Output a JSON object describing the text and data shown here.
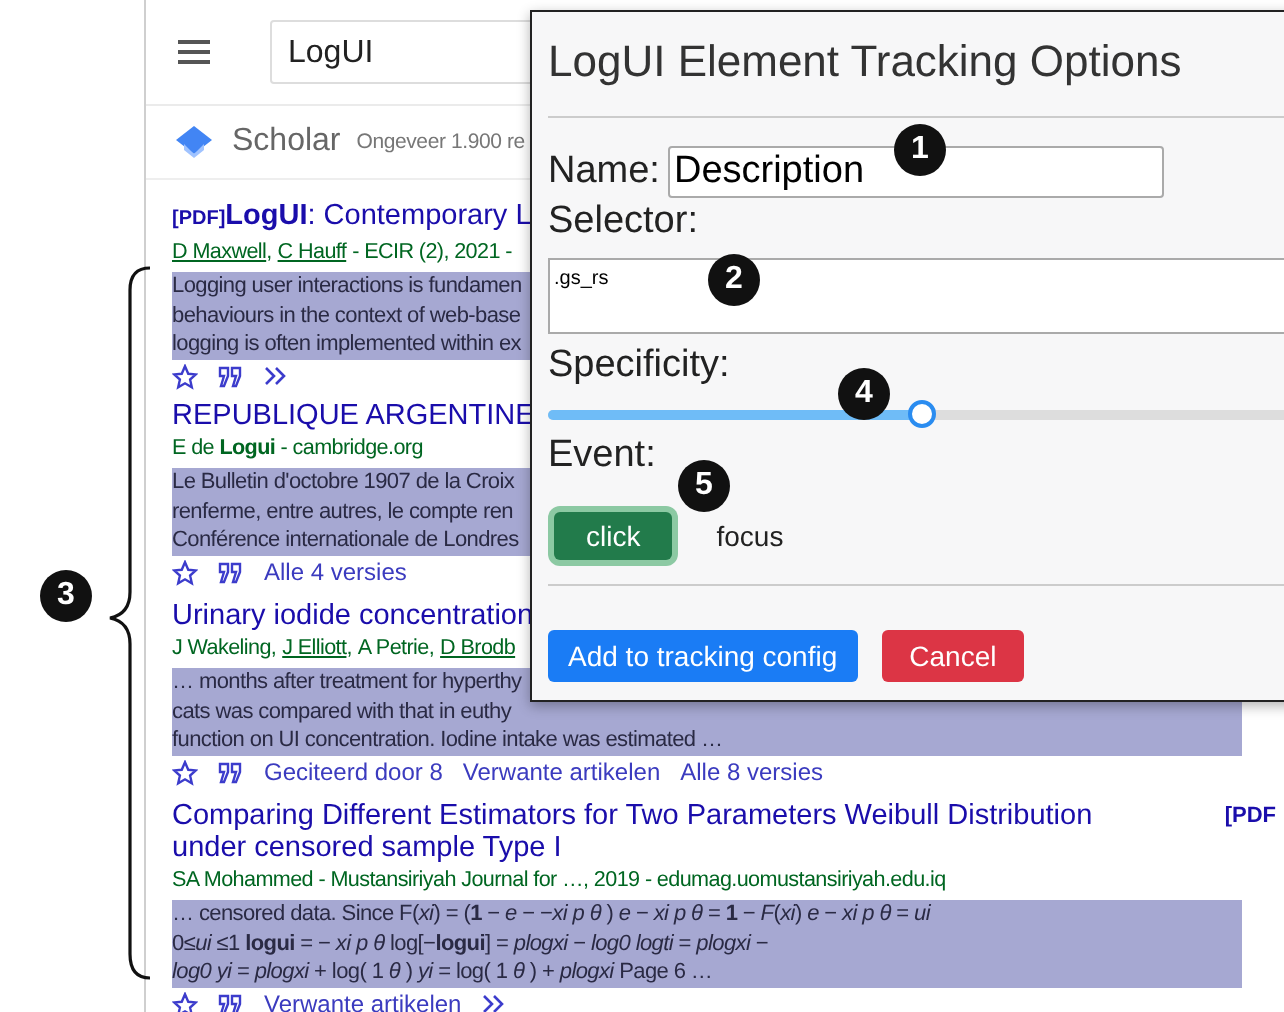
{
  "header": {
    "search_value": "LogUI"
  },
  "scholar_bar": {
    "title": "Scholar",
    "result_count": "Ongeveer 1.900 re"
  },
  "results": [
    {
      "pdf_tag": "[PDF]",
      "title": "**LogUI**: Contemporary L",
      "authors": [
        {
          "name": "D Maxwell",
          "sep": ",",
          "link": true
        },
        {
          "name": "C Hauff",
          "link": true
        }
      ],
      "source": "- ECIR (2), 2021 -",
      "snippet": [
        "Logging user interactions is fundamen",
        "behaviours in the context of web-base",
        "logging is often implemented within ex"
      ],
      "actions": [
        {
          "kind": "star"
        },
        {
          "kind": "cite"
        },
        {
          "kind": "more"
        }
      ]
    },
    {
      "title": "REPUBLIQUE ARGENTINE",
      "source": "E de **Logui** - cambridge.org",
      "snippet": [
        "Le Bulletin d'octobre 1907 de la Croix",
        "renferme, entre autres, le compte ren",
        "Conférence internationale de Londres"
      ],
      "actions": [
        {
          "kind": "star"
        },
        {
          "kind": "cite"
        },
        {
          "kind": "link",
          "label": "Alle 4 versies"
        }
      ]
    },
    {
      "title": "Urinary iodide concentration",
      "authors": [
        {
          "name": "J Wakeling",
          "sep": ",",
          "link": false
        },
        {
          "name": "J Elliott",
          "sep": ",",
          "link": true
        },
        {
          "name": "A Petrie",
          "sep": ",",
          "link": false
        },
        {
          "name": "D Brodb",
          "link": true
        }
      ],
      "snippet": [
        "… months after treatment for hyperthy",
        "cats was compared with that in euthy",
        "function on UI concentration. Iodine intake was estimated …"
      ],
      "actions": [
        {
          "kind": "star"
        },
        {
          "kind": "cite"
        },
        {
          "kind": "link",
          "label": "Geciteerd door 8"
        },
        {
          "kind": "link",
          "label": "Verwante artikelen"
        },
        {
          "kind": "link",
          "label": "Alle 8 versies"
        }
      ]
    },
    {
      "title": "Comparing Different Estimators for Two Parameters Weibull Distribution under censored sample Type I",
      "side_link": "[PDF",
      "source": "SA Mohammed - Mustansiriyah Journal for …, 2019 - edumag.uomustansiriyah.edu.iq",
      "snippet": [
        "… censored data. Since F(*xi*) = (**1** − *e* − −*xi p θ* ) *e* − *xi p θ* = **1** − *F*(*xi*) *e* − *xi p θ* = *ui*",
        "0≤*ui* ≤1 **logui** = − *xi p θ* log[−**logui**] = *plogxi* − *log0* *logti* = *plogxi* −",
        "*log0 yi* = *plogxi* + log( 1 *θ* ) *yi* = log( 1 *θ* ) + *plogxi* Page 6 …"
      ],
      "actions": [
        {
          "kind": "star"
        },
        {
          "kind": "cite"
        },
        {
          "kind": "link",
          "label": "Verwante artikelen"
        },
        {
          "kind": "more"
        }
      ]
    }
  ],
  "dialog": {
    "title": "LogUI Element Tracking Options",
    "name_label": "Name:",
    "name_value": "Description",
    "selector_label": "Selector:",
    "selector_value": ".gs_rs",
    "specificity_label": "Specificity:",
    "specificity": {
      "level": 0.5
    },
    "event_label": "Event:",
    "events": [
      {
        "label": "click",
        "selected": true
      },
      {
        "label": "focus",
        "selected": false
      }
    ],
    "buttons": [
      {
        "kind": "primary",
        "label": "Add to tracking config"
      },
      {
        "kind": "danger",
        "label": "Cancel"
      }
    ]
  },
  "callouts": [
    "1",
    "2",
    "3",
    "4",
    "5"
  ]
}
